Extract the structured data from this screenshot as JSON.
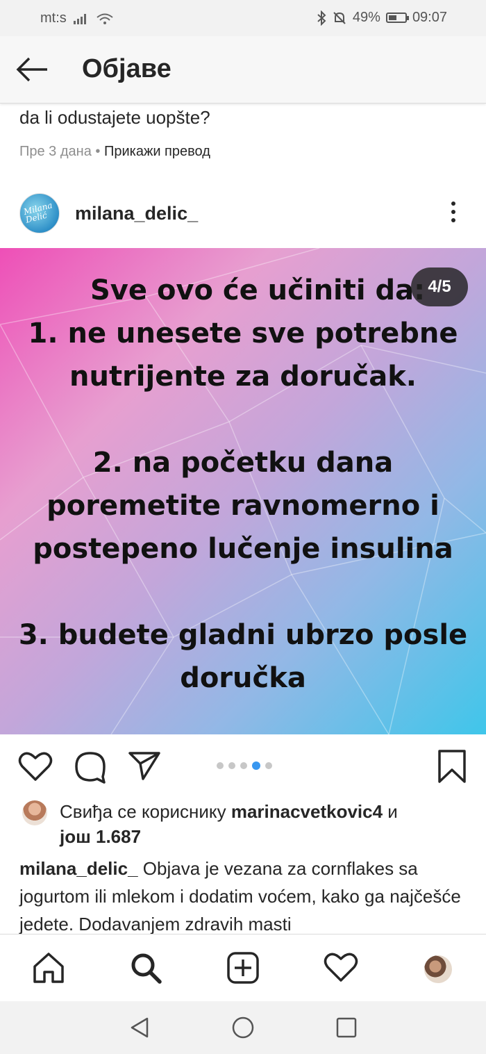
{
  "status_bar": {
    "carrier": "mt:s",
    "battery_percent": "49%",
    "battery_level": 0.49,
    "time": "09:07"
  },
  "app_bar": {
    "title": "Објаве"
  },
  "previous_post": {
    "caption_tail": "da li odustajete uopšte?",
    "time_ago": "Пре 3 дана",
    "separator": "•",
    "translate_label": "Прикажи превод"
  },
  "post": {
    "username": "milana_delic_",
    "avatar_text": "Milana Delić",
    "slide_counter": "4/5",
    "carousel": {
      "total": 5,
      "current": 4
    },
    "slide": {
      "heading": "Sve ovo će učiniti da:",
      "item1_line1": "1. ne unesete sve potrebne",
      "item1_line2": "nutrijente za doručak.",
      "item2_line1": "2. na početku dana",
      "item2_line2": "poremetite ravnomerno i",
      "item2_line3": "postepeno lučenje insulina",
      "item3_line1": "3. budete gladni ubrzo posle",
      "item3_line2": "doručka"
    },
    "likes": {
      "prefix": "Свиђа се кориснику ",
      "user": "marinacvetkovic4",
      "middle": " и",
      "count_text": "још 1.687"
    },
    "caption": {
      "username": "milana_delic_",
      "text": " Objava je vezana za cornflakes sa jogurtom ili mlekom i dodatim voćem, kako ga najčešće jedete. Dodavanjem zdravih masti"
    }
  },
  "colors": {
    "accent_blue": "#3897f0",
    "text": "#262626",
    "muted": "#8e8e8e",
    "gradient_pink": "#ee4fb7",
    "gradient_cyan": "#3fc6ea"
  },
  "icons": {
    "back": "arrow-left-icon",
    "more": "three-dots-vertical-icon",
    "like": "heart-icon",
    "comment": "speech-bubble-icon",
    "share": "paper-plane-icon",
    "save": "bookmark-icon",
    "home": "home-icon",
    "search": "search-icon",
    "add": "plus-square-icon",
    "activity": "heart-icon",
    "profile": "profile-avatar",
    "sys_back": "triangle-back-icon",
    "sys_home": "circle-home-icon",
    "sys_recent": "square-recent-icon"
  }
}
